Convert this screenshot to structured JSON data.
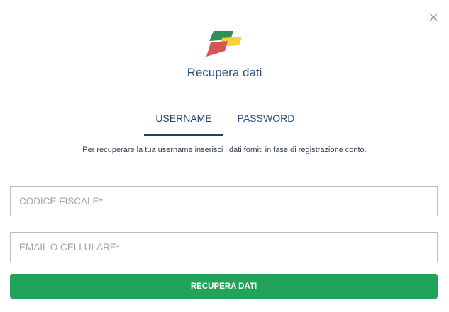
{
  "dialog": {
    "close_symbol": "×",
    "title": "Recupera dati"
  },
  "tabs": [
    {
      "label": "USERNAME",
      "active": true
    },
    {
      "label": "PASSWORD",
      "active": false
    }
  ],
  "description": "Per recuperare la tua username inserisci i dati forniti in fase di registrazione conto.",
  "form": {
    "codice_fiscale": {
      "value": "",
      "placeholder": "CODICE FISCALE*"
    },
    "email_cellulare": {
      "value": "",
      "placeholder": "EMAIL O CELLULARE*"
    },
    "submit_label": "RECUPERA DATI"
  },
  "colors": {
    "brand_green": "#2f8f55",
    "brand_yellow": "#f2d33a",
    "brand_red": "#d9534f",
    "button_green": "#23a35a",
    "text_navy": "#1f3f6b"
  }
}
